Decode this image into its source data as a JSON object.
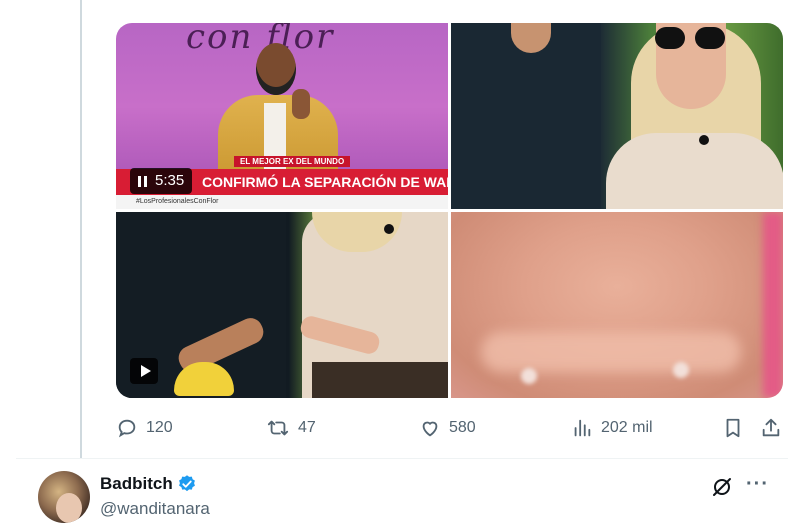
{
  "quoted_text": "",
  "media": {
    "tile1": {
      "logo": "con flor",
      "banner_small": "EL MEJOR EX DEL MUNDO",
      "banner_text": "CONFIRMÓ LA SEPARACIÓN DE WANDA Y MIGUELES",
      "strip_text": "#LosProfesionalesConFlor",
      "video_duration": "5:35"
    }
  },
  "actions": {
    "replies": "120",
    "retweets": "47",
    "likes": "580",
    "views": "202 mil"
  },
  "next_tweet": {
    "display_name": "Badbitch",
    "handle": "@wanditanara"
  },
  "colors": {
    "text_secondary": "#536471",
    "text_primary": "#0f1419",
    "verified_blue": "#1d9bf0",
    "banner_red": "#d81d34"
  }
}
